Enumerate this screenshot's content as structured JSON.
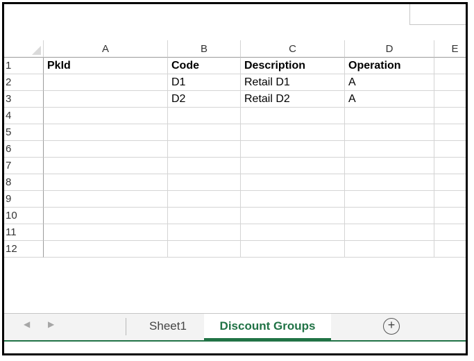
{
  "columns": [
    "A",
    "B",
    "C",
    "D",
    "E"
  ],
  "rows": [
    {
      "num": "1",
      "cells": [
        "PkId",
        "Code",
        "Description",
        "Operation",
        ""
      ]
    },
    {
      "num": "2",
      "cells": [
        "",
        "D1",
        "Retail D1",
        "A",
        ""
      ]
    },
    {
      "num": "3",
      "cells": [
        "",
        "D2",
        "Retail D2",
        "A",
        ""
      ]
    },
    {
      "num": "4",
      "cells": [
        "",
        "",
        "",
        "",
        ""
      ]
    },
    {
      "num": "5",
      "cells": [
        "",
        "",
        "",
        "",
        ""
      ]
    },
    {
      "num": "6",
      "cells": [
        "",
        "",
        "",
        "",
        ""
      ]
    },
    {
      "num": "7",
      "cells": [
        "",
        "",
        "",
        "",
        ""
      ]
    },
    {
      "num": "8",
      "cells": [
        "",
        "",
        "",
        "",
        ""
      ]
    },
    {
      "num": "9",
      "cells": [
        "",
        "",
        "",
        "",
        ""
      ]
    },
    {
      "num": "10",
      "cells": [
        "",
        "",
        "",
        "",
        ""
      ]
    },
    {
      "num": "11",
      "cells": [
        "",
        "",
        "",
        "",
        ""
      ]
    },
    {
      "num": "12",
      "cells": [
        "",
        "",
        "",
        "",
        ""
      ]
    }
  ],
  "sheet_tabs": [
    {
      "label": "Sheet1",
      "active": false
    },
    {
      "label": "Discount Groups",
      "active": true
    }
  ],
  "nav": {
    "prev_icon": "triangle-left-icon",
    "next_icon": "triangle-right-icon"
  },
  "add_sheet": {
    "icon": "plus-circle-icon",
    "symbol": "+"
  },
  "colors": {
    "accent": "#217346",
    "gridline": "#d4d4d4",
    "header_border": "#9b9b9b"
  }
}
